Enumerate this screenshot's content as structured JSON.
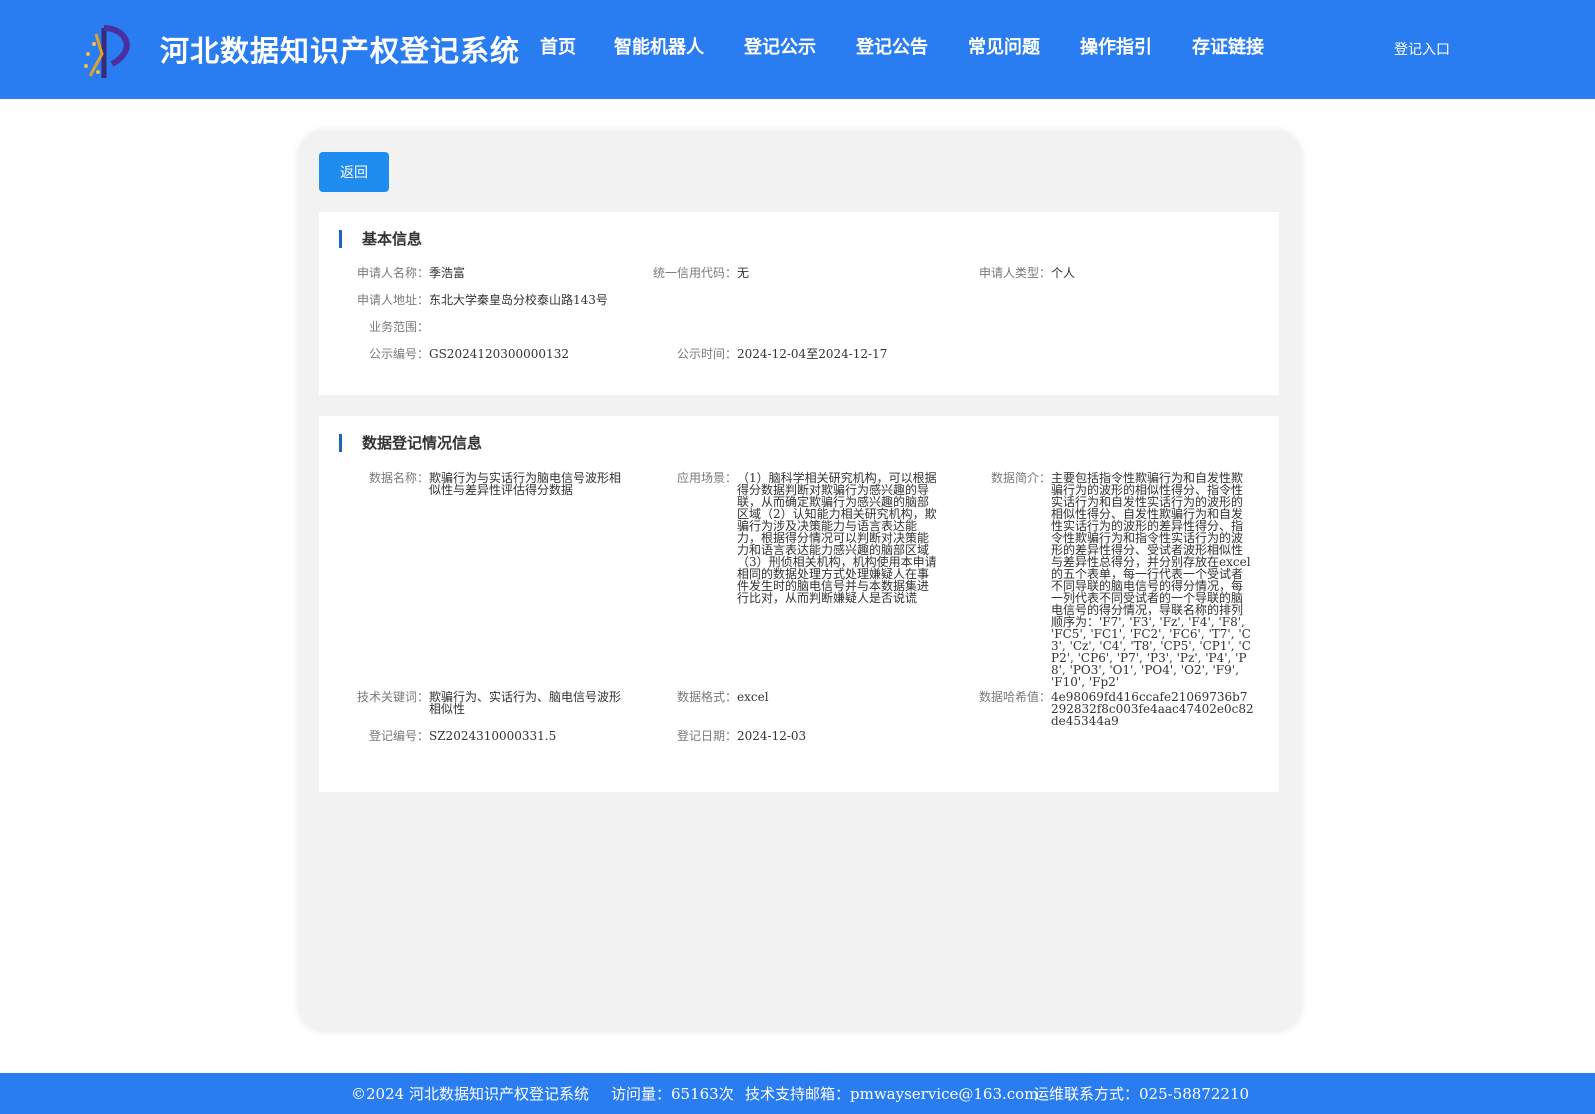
{
  "header": {
    "site_title": "河北数据知识产权登记系统",
    "nav": [
      "首页",
      "智能机器人",
      "登记公示",
      "登记公告",
      "常见问题",
      "操作指引",
      "存证链接"
    ],
    "login": "登记入口"
  },
  "back_label": "返回",
  "basic": {
    "title": "基本信息",
    "applicant_name_label": "申请人名称：",
    "applicant_name": "季浩富",
    "credit_code_label": "统一信用代码：",
    "credit_code": "无",
    "applicant_type_label": "申请人类型：",
    "applicant_type": "个人",
    "address_label": "申请人地址：",
    "address": "东北大学秦皇岛分校泰山路143号",
    "scope_label": "业务范围：",
    "scope": "",
    "notice_no_label": "公示编号：",
    "notice_no": "GS2024120300000132",
    "notice_time_label": "公示时间：",
    "notice_time": "2024-12-04至2024-12-17"
  },
  "registration": {
    "title": "数据登记情况信息",
    "data_name_label": "数据名称：",
    "data_name": "欺骗行为与实话行为脑电信号波形相似性与差异性评估得分数据",
    "scene_label": "应用场景：",
    "scene": "（1）脑科学相关研究机构，可以根据得分数据判断对欺骗行为感兴趣的导联，从而确定欺骗行为感兴趣的脑部区域（2）认知能力相关研究机构，欺骗行为涉及决策能力与语言表达能力，根据得分情况可以判断对决策能力和语言表达能力感兴趣的脑部区域（3）刑侦相关机构，机构使用本申请相同的数据处理方式处理嫌疑人在事件发生时的脑电信号并与本数据集进行比对，从而判断嫌疑人是否说谎",
    "summary_label": "数据简介：",
    "summary": "主要包括指令性欺骗行为和自发性欺骗行为的波形的相似性得分、指令性实话行为和自发性实话行为的波形的相似性得分、自发性欺骗行为和自发性实话行为的波形的差异性得分、指令性欺骗行为和指令性实话行为的波形的差异性得分、受试者波形相似性与差异性总得分，并分别存放在excel的五个表单，每一行代表一个受试者不同导联的脑电信号的得分情况，每一列代表不同受试者的一个导联的脑电信号的得分情况，导联名称的排列顺序为：'F7', 'F3', 'Fz', 'F4', 'F8', 'FC5', 'FC1', 'FC2', 'FC6', 'T7', 'C3', 'Cz', 'C4', 'T8', 'CP5', 'CP1', 'CP2', 'CP6', 'P7', 'P3', 'Pz', 'P4', 'P8', 'PO3', 'O1', 'PO4', 'O2', 'F9', 'F10', 'Fp2'",
    "keywords_label": "技术关键词：",
    "keywords": "欺骗行为、实话行为、脑电信号波形相似性",
    "format_label": "数据格式：",
    "format": "excel",
    "hash_label": "数据哈希值：",
    "hash": "4e98069fd416ccafe21069736b7292832f8c003fe4aac47402e0c82de45344a9",
    "reg_no_label": "登记编号：",
    "reg_no": "SZ2024310000331.5",
    "reg_date_label": "登记日期：",
    "reg_date": "2024-12-03"
  },
  "footer": {
    "copyright": "©2024 河北数据知识产权登记系统",
    "visits": "访问量：65163次",
    "email": "技术支持邮箱：pmwayservice@163.com",
    "contact": "运维联系方式：025-58872210"
  }
}
